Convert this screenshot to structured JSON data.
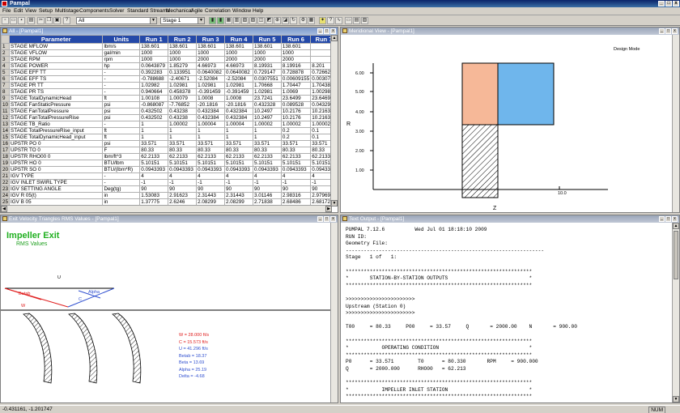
{
  "app": {
    "title": "Pampal"
  },
  "menu": [
    "File",
    "Edit",
    "View",
    "Setup",
    "Multistage",
    "Components",
    "Solver",
    "Standard Streams",
    "Mechanical",
    "Agile",
    "Correlation",
    "Window",
    "Help"
  ],
  "toolbar": {
    "combo_all": "All",
    "combo_stage": "Stage 1"
  },
  "grid_pane": {
    "title": "All - [Pampal1]",
    "headers": [
      "Parameter",
      "Units",
      "Run 1",
      "Run 2",
      "Run 3",
      "Run 4",
      "Run 5",
      "Run 6",
      "Run 7"
    ],
    "rows": [
      [
        "1",
        "STAGE MFLOW",
        "lbm/s",
        "138.601",
        "138.601",
        "138.601",
        "138.601",
        "138.601",
        "138.601"
      ],
      [
        "2",
        "STAGE VFLOW",
        "gal/min",
        "1000",
        "1000",
        "1000",
        "1000",
        "1000",
        "1000"
      ],
      [
        "3",
        "STAGE RPM",
        "rpm",
        "1000",
        "1000",
        "2000",
        "2000",
        "2000",
        "2000"
      ],
      [
        "4",
        "STAGE POWER",
        "hp",
        "0.0643879",
        "1.85279",
        "4.66973",
        "4.66973",
        "8.19931",
        "8.19916",
        "8.201"
      ],
      [
        "5",
        "STAGE EFF TT",
        "-",
        "0.392283",
        "0.133951",
        "0.0640082",
        "0.0640082",
        "0.729147",
        "0.728878",
        "0.72662"
      ],
      [
        "6",
        "STAGE EFF TS",
        "-",
        "-0.788688",
        "-2.40671",
        "-2.52084",
        "-2.52084",
        "0.0307551",
        "0.00609155",
        "0.00307"
      ],
      [
        "7",
        "STAGE PR TT",
        "-",
        "1.02982",
        "1.02981",
        "1.02981",
        "1.02981",
        "1.70668",
        "1.70447",
        "1.70438"
      ],
      [
        "8",
        "STAGE PR TS",
        "-",
        "0.940664",
        "0.458378",
        "-0.391459",
        "-0.391459",
        "1.02981",
        "1.0069",
        "1.00298"
      ],
      [
        "9",
        "STAGE TotalDynamicHead",
        "ft",
        "1.00108",
        "1.00079",
        "1.0008",
        "1.0008",
        "23.7241",
        "23.6499",
        "23.6469"
      ],
      [
        "10",
        "STAGE FanStaticPressure",
        "psi",
        "-0.868087",
        "-7.76852",
        "-20.1816",
        "-20.1816",
        "0.432328",
        "0.089528",
        "0.04329"
      ],
      [
        "11",
        "STAGE FanTotalPressure",
        "psi",
        "0.432502",
        "0.43238",
        "0.432384",
        "0.432384",
        "10.2497",
        "10.2176",
        "10.2163"
      ],
      [
        "12",
        "STAGE FanTotalPressureRise",
        "psi",
        "0.432502",
        "0.43238",
        "0.432384",
        "0.432384",
        "10.2497",
        "10.2176",
        "10.2163"
      ],
      [
        "13",
        "STAGE TB_Ratio",
        "-",
        "1",
        "1.00002",
        "1.00004",
        "1.00004",
        "1.00002",
        "1.00002",
        "1.00002"
      ],
      [
        "14",
        "STAGE TotalPressureRise_input",
        "ft",
        "1",
        "1",
        "1",
        "1",
        "1",
        "0.2",
        "0.1"
      ],
      [
        "15",
        "STAGE TotalDynamicHead_input",
        "ft",
        "1",
        "1",
        "1",
        "1",
        "1",
        "0.2",
        "0.1"
      ],
      [
        "16",
        "UPSTR PO 0",
        "psi",
        "33.571",
        "33.571",
        "33.571",
        "33.571",
        "33.571",
        "33.571",
        "33.571"
      ],
      [
        "17",
        "UPSTR TO 0",
        "F",
        "80.33",
        "80.33",
        "80.33",
        "80.33",
        "80.33",
        "80.33",
        "80.33"
      ],
      [
        "18",
        "UPSTR RHO00 0",
        "lbm/ft^3",
        "62.2133",
        "62.2133",
        "62.2133",
        "62.2133",
        "62.2133",
        "62.2133",
        "62.2133"
      ],
      [
        "19",
        "UPSTR HO 0",
        "BTU/lbm",
        "5.10151",
        "5.10151",
        "5.10151",
        "5.10151",
        "5.10151",
        "5.10151",
        "5.10151"
      ],
      [
        "20",
        "UPSTR SO 0",
        "BTU/(lbm*R)",
        "0.0943393",
        "0.0943393",
        "0.0943393",
        "0.0943393",
        "0.0943393",
        "0.0943393",
        "0.0943393"
      ],
      [
        "21",
        "IGV TYPE",
        "-",
        "4",
        "4",
        "4",
        "4",
        "4",
        "4",
        "4"
      ],
      [
        "22",
        "IGV INLET SWIRL TYPE",
        "-",
        "-1",
        "-1",
        "-1",
        "-1",
        "-1",
        "-1",
        "-1"
      ],
      [
        "23",
        "IGV SETTING ANGLE",
        "Deg(tg)",
        "90",
        "90",
        "90",
        "90",
        "90",
        "90",
        "90"
      ],
      [
        "24",
        "IGV R 05(t)",
        "in",
        "1.53083",
        "2.91623",
        "2.31443",
        "2.31443",
        "3.01146",
        "2.98316",
        "2.97969"
      ],
      [
        "25",
        "IGV B 05",
        "in",
        "1.37775",
        "2.6246",
        "2.08299",
        "2.08299",
        "2.71838",
        "2.68486",
        "2.68172"
      ]
    ]
  },
  "meridional_pane": {
    "title": "Meridional View - [Pampal1]",
    "mode_label": "Design Mode",
    "ylabel": "R",
    "xlabel": "Z",
    "yticks": [
      "6.00",
      "5.00",
      "4.00",
      "3.00",
      "2.00",
      "1.00"
    ],
    "xtick": "10.0"
  },
  "velocity_pane": {
    "title": "Exit Velocity Triangles RMS Values - [Pampal1]",
    "heading": "Impeller Exit",
    "subheading": "RMS Values",
    "triangle_labels": {
      "u": "U",
      "betab": "Betab",
      "w": "W",
      "c": "C",
      "alpha": "Alpha"
    },
    "values": [
      "W = 28.000 ft/s",
      "C = 15.573 ft/s",
      "U = 41.296 ft/s",
      "Betab = 18.37",
      "Beta = 13.69",
      "Alpha = 25.19",
      "Delta = -4.68"
    ]
  },
  "text_pane": {
    "title": "Text Output - [Pampal1]",
    "lines": [
      "PUMPAL 7.12.6          Wed Jul 01 18:18:10 2009",
      "RUN ID:",
      "Geometry File:",
      "------------------------------------------------------------------",
      "Stage   1 of   1:",
      "",
      "**************************************************************",
      "*       STATION-BY-STATION OUTPUTS                           *",
      "**************************************************************",
      "",
      ">>>>>>>>>>>>>>>>>>>>>>>",
      "Upstream (Station 0)",
      ">>>>>>>>>>>>>>>>>>>>>>>",
      "",
      "T00     = 80.33     P00     = 33.57     Q       = 2000.00    N       = 900.00",
      "",
      "**************************************************************",
      "*           OPERATING CONDITION                              *",
      "**************************************************************",
      "P0      = 33.571        T0      = 80.330       RPM     = 900.000",
      "Q       = 2000.000      RHO00   = 62.213",
      "",
      "**************************************************************",
      "*           IMPELLER INLET STATION                           *",
      "**************************************************************"
    ]
  },
  "status": {
    "coords": "-0.431161, -1.201747",
    "mode": "NUM"
  }
}
